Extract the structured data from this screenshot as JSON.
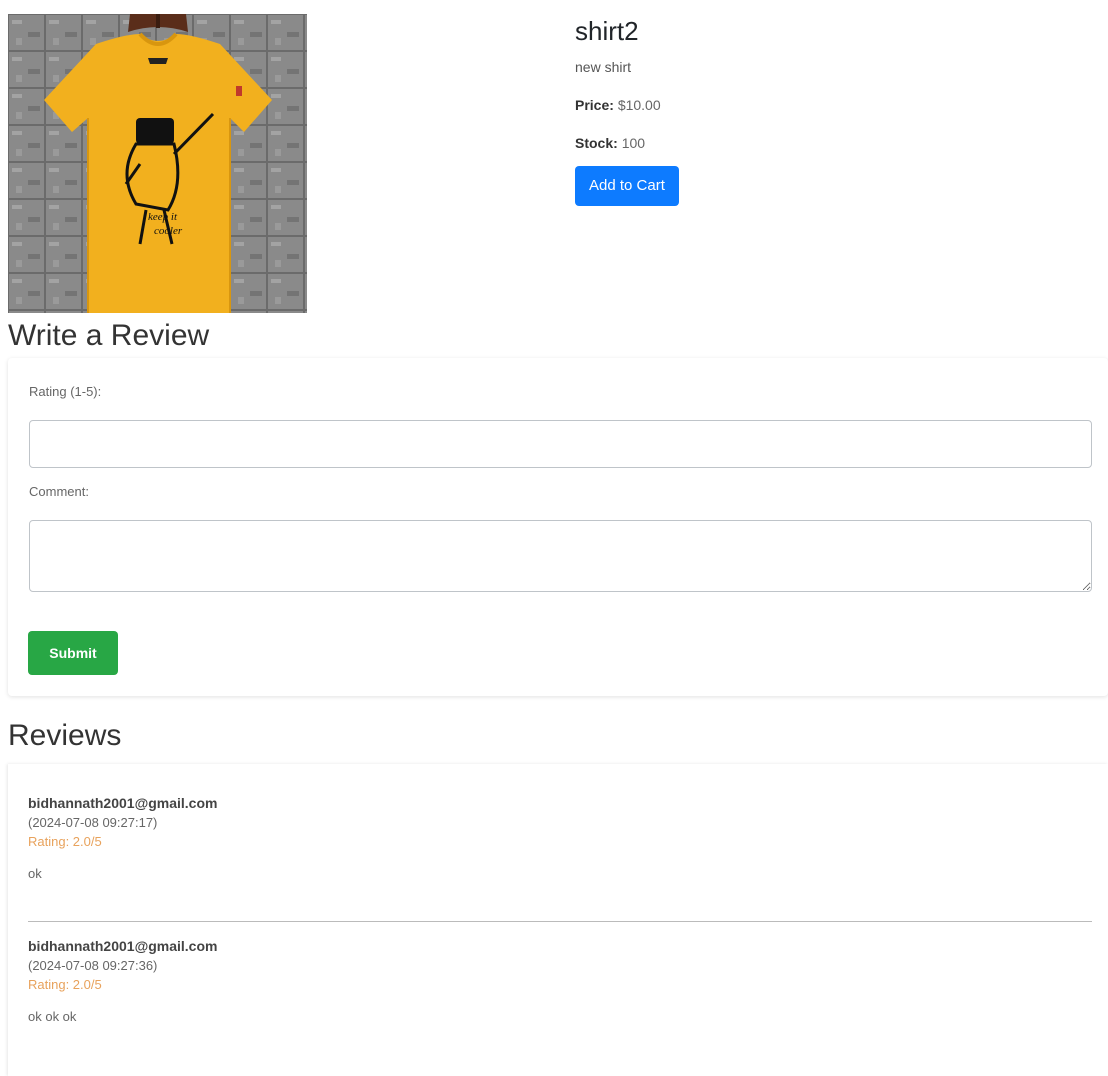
{
  "product": {
    "name": "shirt2",
    "description": "new shirt",
    "price_label": "Price:",
    "price_value": "$10.00",
    "stock_label": "Stock:",
    "stock_value": "100",
    "add_to_cart_label": "Add to Cart",
    "image_print_text": [
      "keep it",
      "cooler"
    ]
  },
  "review_form": {
    "title": "Write a Review",
    "rating_label": "Rating (1-5):",
    "rating_value": "",
    "comment_label": "Comment:",
    "comment_value": "",
    "submit_label": "Submit"
  },
  "reviews": {
    "title": "Reviews",
    "items": [
      {
        "author": "bidhannath2001@gmail.com",
        "date": "(2024-07-08 09:27:17)",
        "rating": "Rating: 2.0/5",
        "comment": "ok"
      },
      {
        "author": "bidhannath2001@gmail.com",
        "date": "(2024-07-08 09:27:36)",
        "rating": "Rating: 2.0/5",
        "comment": "ok ok ok"
      }
    ]
  },
  "colors": {
    "primary": "#0d7bff",
    "success": "#28a745",
    "rating": "#e8a25c",
    "shirt": "#f2b01e"
  }
}
